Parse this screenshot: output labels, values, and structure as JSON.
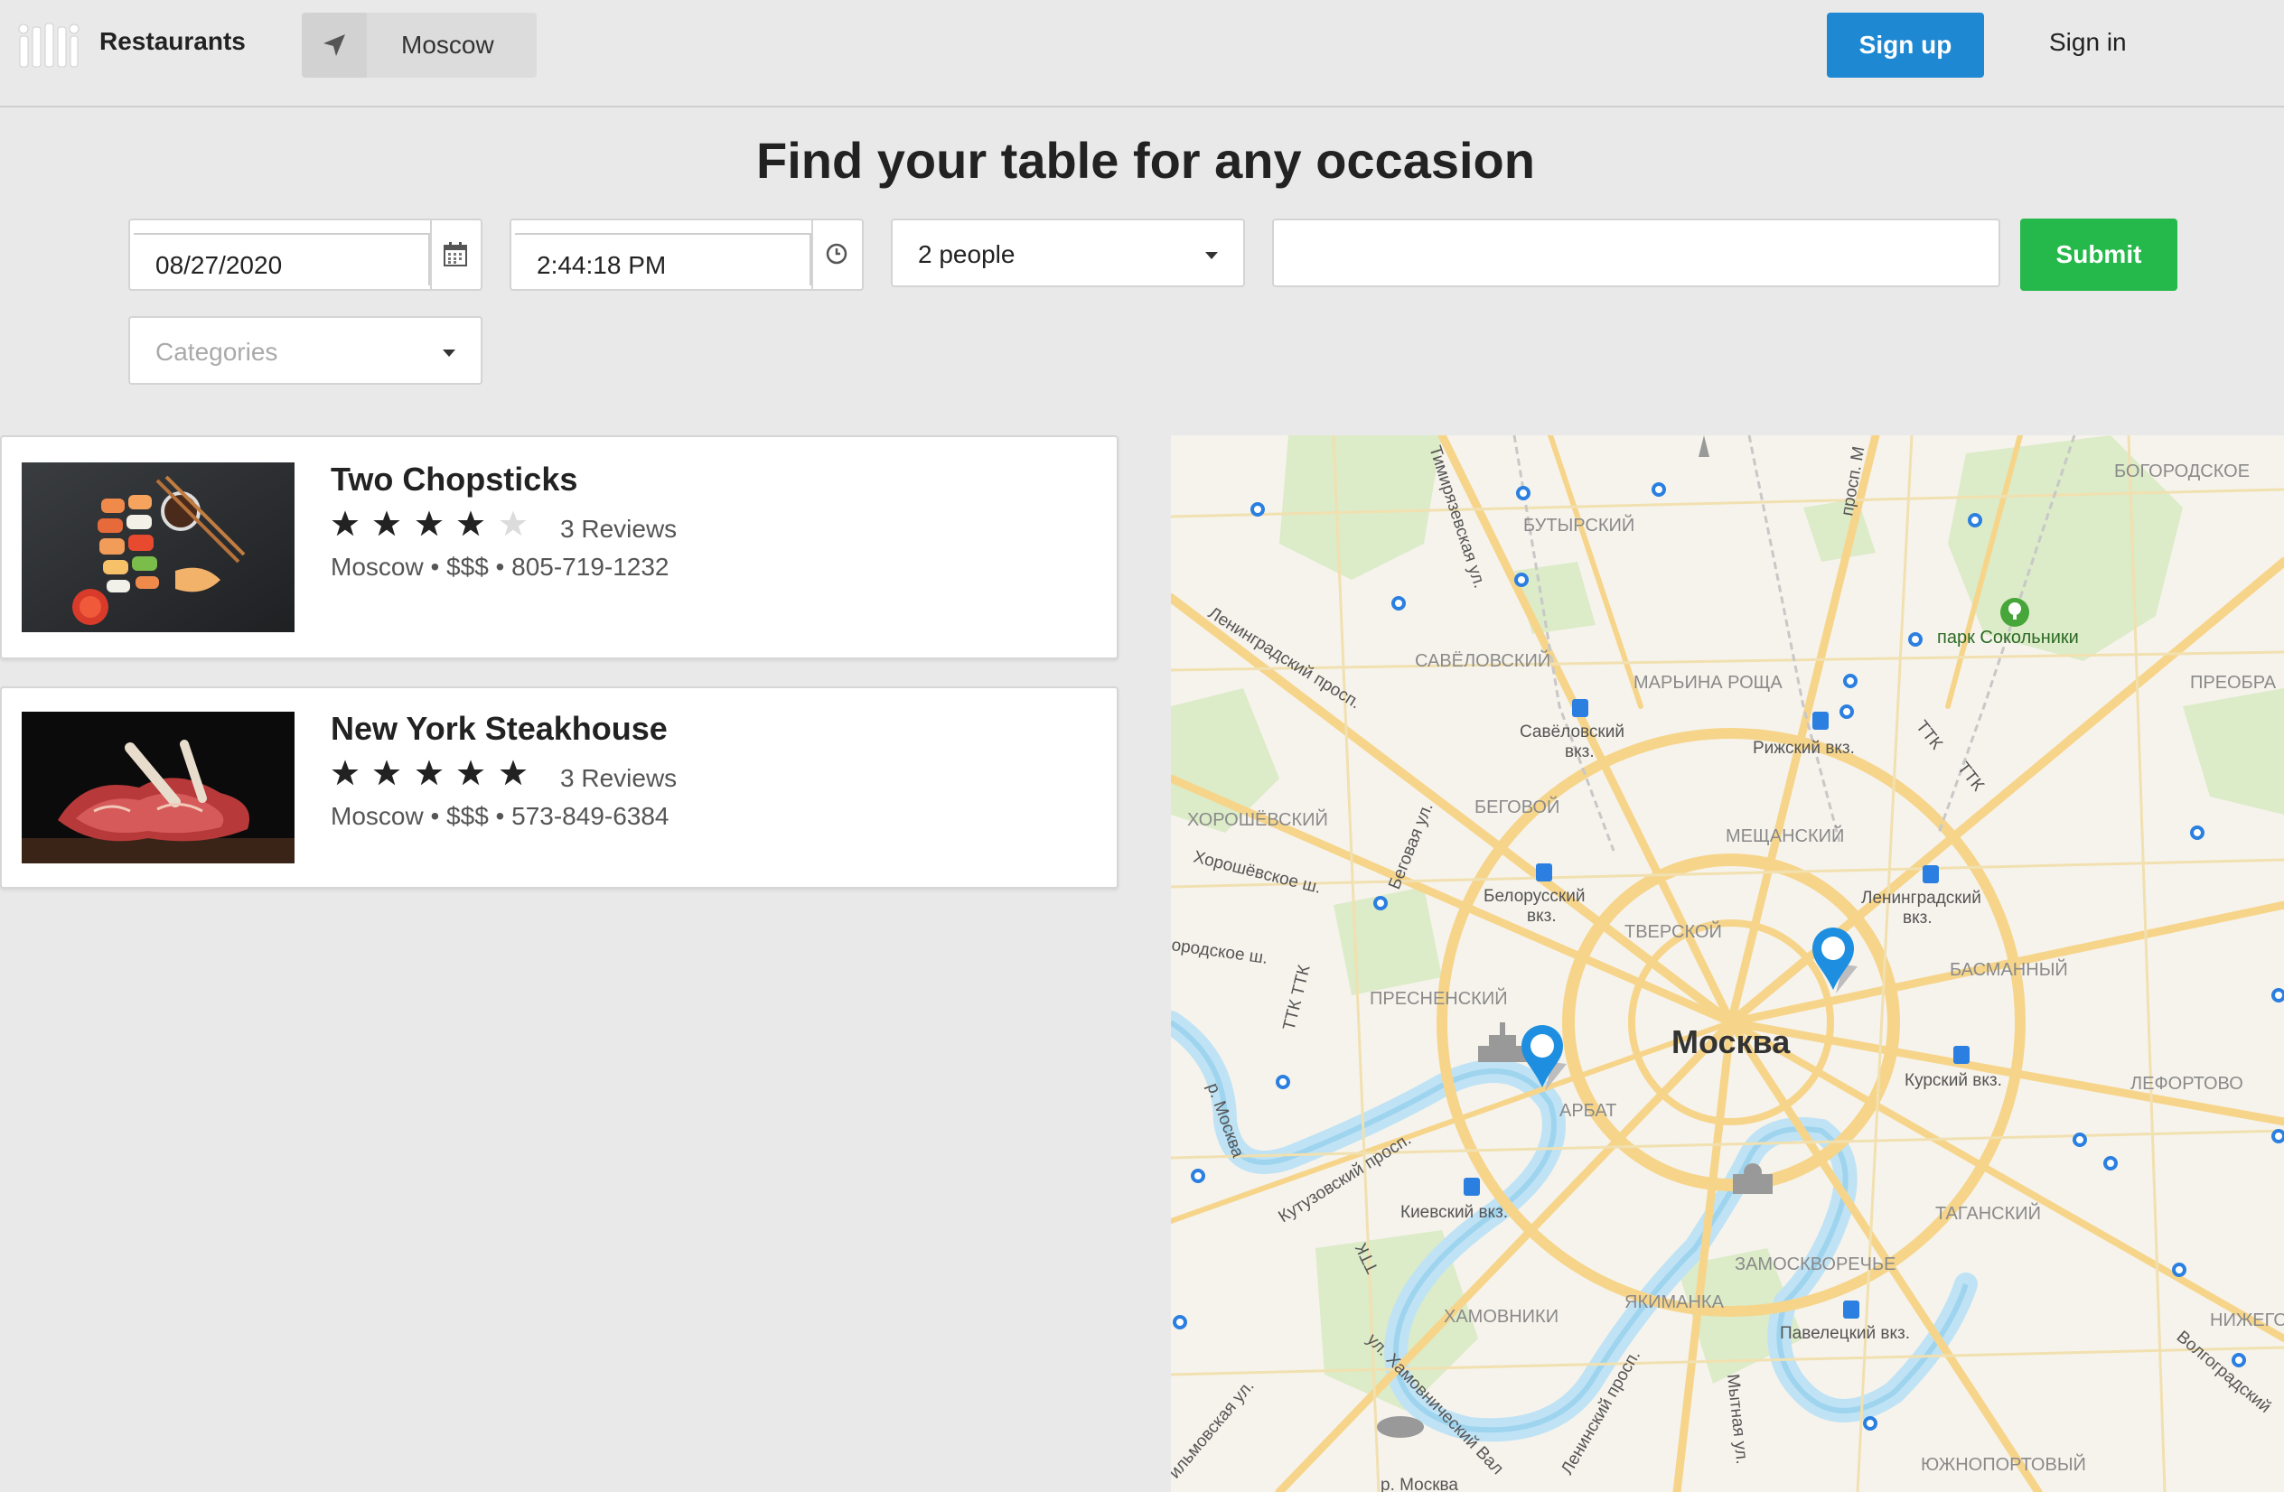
{
  "header": {
    "brand": "Restaurants",
    "location": "Moscow",
    "signup_label": "Sign up",
    "signin_label": "Sign in"
  },
  "search": {
    "headline": "Find your table for any occasion",
    "date": "08/27/2020",
    "time": "2:44:18 PM",
    "party_size": "2 people",
    "query": "",
    "submit_label": "Submit",
    "categories_placeholder": "Categories"
  },
  "results": [
    {
      "name": "Two Chopsticks",
      "rating": 4,
      "max_rating": 5,
      "reviews": "3 Reviews",
      "meta": "Moscow • $$$ • 805-719-1232",
      "image": "sushi-plate"
    },
    {
      "name": "New York Steakhouse",
      "rating": 5,
      "max_rating": 5,
      "reviews": "3 Reviews",
      "meta": "Moscow • $$$ • 573-849-6384",
      "image": "raw-steak"
    }
  ],
  "map": {
    "city_label": "Москва",
    "district_labels": [
      "БУТЫРСКИЙ",
      "САВЁЛОВСКИЙ",
      "МАРЬИНА РОЩА",
      "БОГОРОДСКОЕ",
      "ПРЕОБРА",
      "ХОРОШЁВСКИЙ",
      "БЕГОВОЙ",
      "МЕЩАНСКИЙ",
      "ТВЕРСКОЙ",
      "ПРЕСНЕНСКИЙ",
      "БАСМАННЫЙ",
      "АРБАТ",
      "ЛЕФОРТОВО",
      "ТАГАНСКИЙ",
      "ЗАМОСКВОРЕЧЬЕ",
      "ЯКИМАНКА",
      "ХАМОВНИКИ",
      "НИЖЕГО",
      "ЮЖНОПОРТОВЫЙ"
    ],
    "station_labels": [
      "Савёловский вкз.",
      "Рижский вкз.",
      "Белорусский вкз.",
      "Ленинградский вкз.",
      "Курский вкз.",
      "Киевский вкз.",
      "Павелецкий вкз."
    ],
    "street_labels": [
      "Тимирязевская ул.",
      "Ленинградский просп.",
      "Беговая ул.",
      "Хорошёвское ш.",
      "ТТК",
      "Кутузовский просп.",
      "р. Москва",
      "ул. Хамовнический Вал",
      "Ленинский просп.",
      "Мытная ул.",
      "Волгоградский",
      "просп. М",
      "ородское ш.",
      "ильмовская ул."
    ],
    "park_label": "парк Сокольники",
    "pins": 2
  },
  "colors": {
    "signup": "#1e88d2",
    "submit": "#25b84a",
    "background": "#e9e9e9",
    "map_road": "#f7d27a",
    "pin": "#1e8fe0"
  }
}
